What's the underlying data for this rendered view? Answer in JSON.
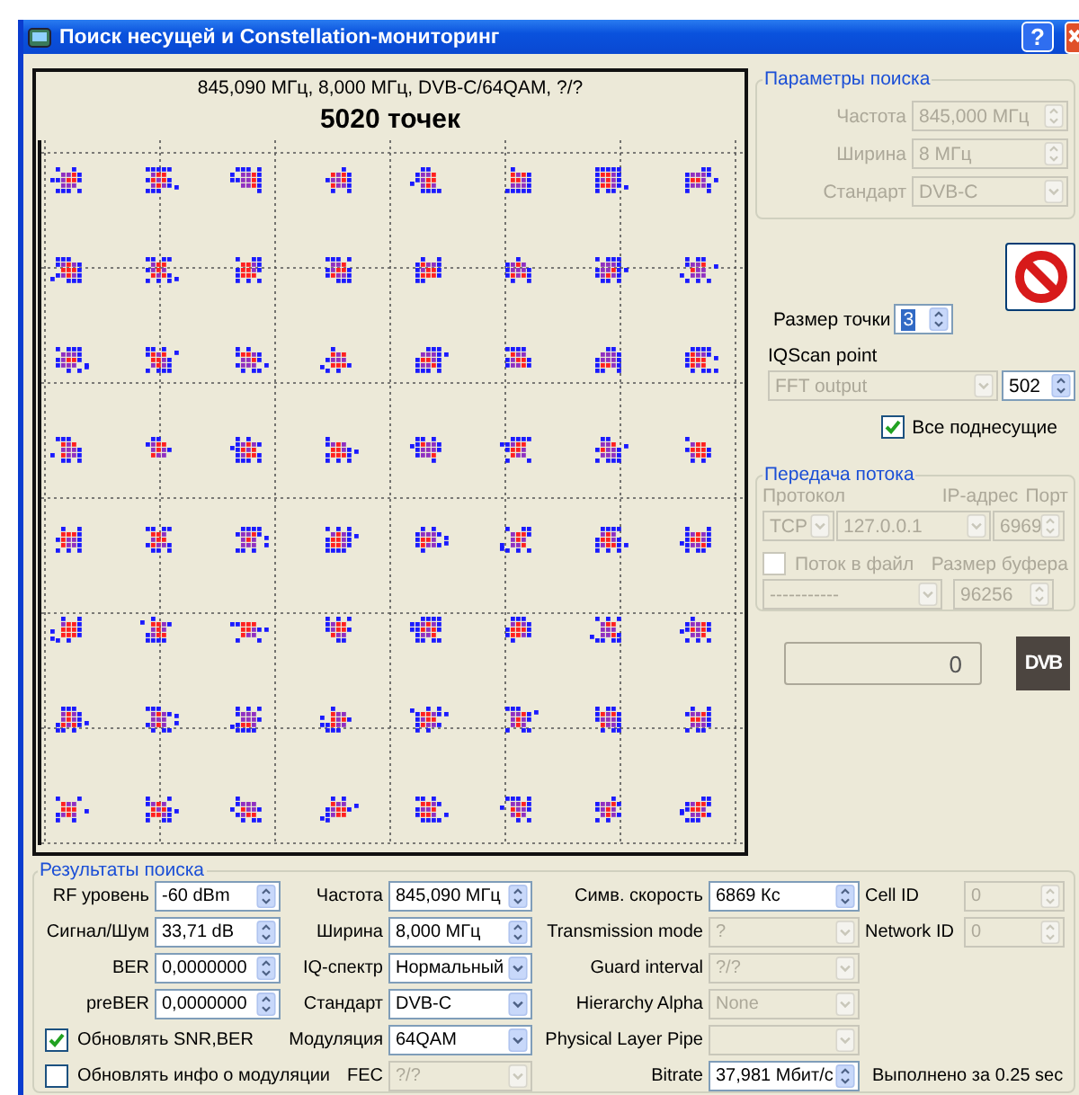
{
  "window": {
    "title": "Поиск несущей и Constellation-мониторинг",
    "help": "?"
  },
  "constellation": {
    "info": "845,090 МГц, 8,000 МГц, DVB-C/64QAM, ?/?",
    "points": "5020 точек"
  },
  "search_params": {
    "title": "Параметры поиска",
    "fields": [
      {
        "label": "Частота",
        "value": "845,000 МГц",
        "kind": "spin",
        "disabled": true
      },
      {
        "label": "Ширина",
        "value": "8 МГц",
        "kind": "spin",
        "disabled": true
      },
      {
        "label": "Стандарт",
        "value": "DVB-C",
        "kind": "combo",
        "disabled": true
      }
    ]
  },
  "point_size": {
    "label": "Размер точки",
    "value": "3"
  },
  "iqscan": {
    "label": "IQScan point",
    "source": "FFT output",
    "source_disabled": true,
    "value": "502"
  },
  "all_subcarriers": {
    "label": "Все поднесущие",
    "checked": true
  },
  "stream": {
    "title": "Передача потока",
    "protocol_label": "Протокол",
    "ip_label": "IP-адрес",
    "port_label": "Порт",
    "protocol": "TCP",
    "ip": "127.0.0.1",
    "port": "6969",
    "to_file": {
      "label": "Поток в файл",
      "checked": false
    },
    "file": "-----------",
    "buffer_label": "Размер буфера",
    "buffer": "96256"
  },
  "counter": "0",
  "logo": "DVB",
  "results": {
    "title": "Результаты поиска",
    "columns": [
      {
        "items": [
          {
            "kind": "spin",
            "label": "RF уровень",
            "value": "-60 dBm",
            "disabled": false
          },
          {
            "kind": "spin",
            "label": "Сигнал/Шум",
            "value": "33,71 dB",
            "disabled": false
          },
          {
            "kind": "spin",
            "label": "BER",
            "value": "0,0000000",
            "disabled": false
          },
          {
            "kind": "spin",
            "label": "preBER",
            "value": "0,0000000",
            "disabled": false
          },
          {
            "kind": "checkbox",
            "label": "Обновлять SNR,BER",
            "checked": true
          },
          {
            "kind": "checkbox",
            "label": "Обновлять инфо о модуляции",
            "checked": false
          }
        ]
      },
      {
        "items": [
          {
            "kind": "spin",
            "label": "Частота",
            "value": "845,090 МГц",
            "disabled": false
          },
          {
            "kind": "spin",
            "label": "Ширина",
            "value": "8,000 МГц",
            "disabled": false
          },
          {
            "kind": "combo",
            "label": "IQ-спектр",
            "value": "Нормальный",
            "disabled": false
          },
          {
            "kind": "combo",
            "label": "Стандарт",
            "value": "DVB-C",
            "disabled": false
          },
          {
            "kind": "combo",
            "label": "Модуляция",
            "value": "64QAM",
            "disabled": false
          },
          {
            "kind": "combo",
            "label": "FEC",
            "value": "?/?",
            "disabled": true
          }
        ]
      },
      {
        "items": [
          {
            "kind": "spin",
            "label": "Симв. скорость",
            "value": "6869 Кс",
            "disabled": false
          },
          {
            "kind": "combo",
            "label": "Transmission mode",
            "value": "?",
            "disabled": true
          },
          {
            "kind": "combo",
            "label": "Guard interval",
            "value": "?/?",
            "disabled": true
          },
          {
            "kind": "combo",
            "label": "Hierarchy Alpha",
            "value": "None",
            "disabled": true
          },
          {
            "kind": "combo",
            "label": "Physical Layer Pipe",
            "disabled": true
          },
          {
            "kind": "spin",
            "label": "Bitrate",
            "value": "37,981 Мбит/с",
            "disabled": false
          }
        ]
      },
      {
        "items": [
          {
            "kind": "spin",
            "label": "Cell ID",
            "value": "0",
            "disabled": true
          },
          {
            "kind": "spin",
            "label": "Network ID",
            "value": "0",
            "disabled": true
          }
        ]
      }
    ],
    "status": "Выполнено за 0.25 sec"
  }
}
